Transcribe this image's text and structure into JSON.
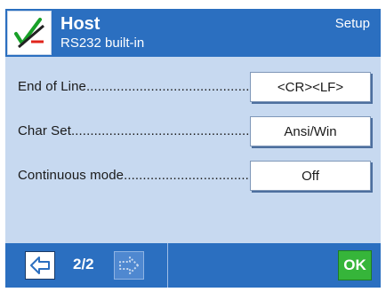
{
  "header": {
    "title": "Host",
    "subtitle": "RS232 built-in",
    "section": "Setup",
    "icon": "checkmark-pen-icon"
  },
  "settings": [
    {
      "label": "End of Line",
      "value": "<CR><LF>"
    },
    {
      "label": "Char Set",
      "value": "Ansi/Win"
    },
    {
      "label": "Continuous mode",
      "value": "Off"
    }
  ],
  "footer": {
    "page_indicator": "2/2",
    "ok_label": "OK",
    "prev_icon": "arrow-left-icon",
    "next_icon": "arrow-right-icon"
  },
  "colors": {
    "header": "#2b6fc0",
    "content": "#c7d9f0",
    "ok": "#36b53a"
  }
}
